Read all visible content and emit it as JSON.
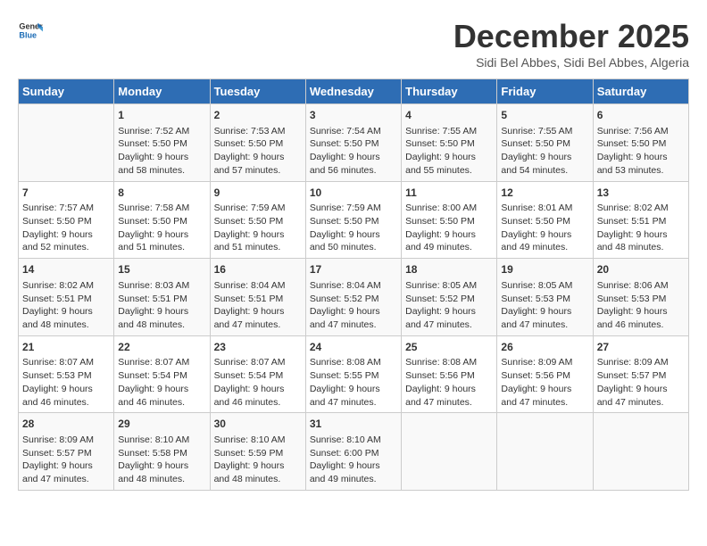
{
  "header": {
    "logo_line1": "General",
    "logo_line2": "Blue",
    "title": "December 2025",
    "subtitle": "Sidi Bel Abbes, Sidi Bel Abbes, Algeria"
  },
  "calendar": {
    "days_of_week": [
      "Sunday",
      "Monday",
      "Tuesday",
      "Wednesday",
      "Thursday",
      "Friday",
      "Saturday"
    ],
    "weeks": [
      [
        {
          "day": "",
          "info": ""
        },
        {
          "day": "1",
          "info": "Sunrise: 7:52 AM\nSunset: 5:50 PM\nDaylight: 9 hours\nand 58 minutes."
        },
        {
          "day": "2",
          "info": "Sunrise: 7:53 AM\nSunset: 5:50 PM\nDaylight: 9 hours\nand 57 minutes."
        },
        {
          "day": "3",
          "info": "Sunrise: 7:54 AM\nSunset: 5:50 PM\nDaylight: 9 hours\nand 56 minutes."
        },
        {
          "day": "4",
          "info": "Sunrise: 7:55 AM\nSunset: 5:50 PM\nDaylight: 9 hours\nand 55 minutes."
        },
        {
          "day": "5",
          "info": "Sunrise: 7:55 AM\nSunset: 5:50 PM\nDaylight: 9 hours\nand 54 minutes."
        },
        {
          "day": "6",
          "info": "Sunrise: 7:56 AM\nSunset: 5:50 PM\nDaylight: 9 hours\nand 53 minutes."
        }
      ],
      [
        {
          "day": "7",
          "info": "Sunrise: 7:57 AM\nSunset: 5:50 PM\nDaylight: 9 hours\nand 52 minutes."
        },
        {
          "day": "8",
          "info": "Sunrise: 7:58 AM\nSunset: 5:50 PM\nDaylight: 9 hours\nand 51 minutes."
        },
        {
          "day": "9",
          "info": "Sunrise: 7:59 AM\nSunset: 5:50 PM\nDaylight: 9 hours\nand 51 minutes."
        },
        {
          "day": "10",
          "info": "Sunrise: 7:59 AM\nSunset: 5:50 PM\nDaylight: 9 hours\nand 50 minutes."
        },
        {
          "day": "11",
          "info": "Sunrise: 8:00 AM\nSunset: 5:50 PM\nDaylight: 9 hours\nand 49 minutes."
        },
        {
          "day": "12",
          "info": "Sunrise: 8:01 AM\nSunset: 5:50 PM\nDaylight: 9 hours\nand 49 minutes."
        },
        {
          "day": "13",
          "info": "Sunrise: 8:02 AM\nSunset: 5:51 PM\nDaylight: 9 hours\nand 48 minutes."
        }
      ],
      [
        {
          "day": "14",
          "info": "Sunrise: 8:02 AM\nSunset: 5:51 PM\nDaylight: 9 hours\nand 48 minutes."
        },
        {
          "day": "15",
          "info": "Sunrise: 8:03 AM\nSunset: 5:51 PM\nDaylight: 9 hours\nand 48 minutes."
        },
        {
          "day": "16",
          "info": "Sunrise: 8:04 AM\nSunset: 5:51 PM\nDaylight: 9 hours\nand 47 minutes."
        },
        {
          "day": "17",
          "info": "Sunrise: 8:04 AM\nSunset: 5:52 PM\nDaylight: 9 hours\nand 47 minutes."
        },
        {
          "day": "18",
          "info": "Sunrise: 8:05 AM\nSunset: 5:52 PM\nDaylight: 9 hours\nand 47 minutes."
        },
        {
          "day": "19",
          "info": "Sunrise: 8:05 AM\nSunset: 5:53 PM\nDaylight: 9 hours\nand 47 minutes."
        },
        {
          "day": "20",
          "info": "Sunrise: 8:06 AM\nSunset: 5:53 PM\nDaylight: 9 hours\nand 46 minutes."
        }
      ],
      [
        {
          "day": "21",
          "info": "Sunrise: 8:07 AM\nSunset: 5:53 PM\nDaylight: 9 hours\nand 46 minutes."
        },
        {
          "day": "22",
          "info": "Sunrise: 8:07 AM\nSunset: 5:54 PM\nDaylight: 9 hours\nand 46 minutes."
        },
        {
          "day": "23",
          "info": "Sunrise: 8:07 AM\nSunset: 5:54 PM\nDaylight: 9 hours\nand 46 minutes."
        },
        {
          "day": "24",
          "info": "Sunrise: 8:08 AM\nSunset: 5:55 PM\nDaylight: 9 hours\nand 47 minutes."
        },
        {
          "day": "25",
          "info": "Sunrise: 8:08 AM\nSunset: 5:56 PM\nDaylight: 9 hours\nand 47 minutes."
        },
        {
          "day": "26",
          "info": "Sunrise: 8:09 AM\nSunset: 5:56 PM\nDaylight: 9 hours\nand 47 minutes."
        },
        {
          "day": "27",
          "info": "Sunrise: 8:09 AM\nSunset: 5:57 PM\nDaylight: 9 hours\nand 47 minutes."
        }
      ],
      [
        {
          "day": "28",
          "info": "Sunrise: 8:09 AM\nSunset: 5:57 PM\nDaylight: 9 hours\nand 47 minutes."
        },
        {
          "day": "29",
          "info": "Sunrise: 8:10 AM\nSunset: 5:58 PM\nDaylight: 9 hours\nand 48 minutes."
        },
        {
          "day": "30",
          "info": "Sunrise: 8:10 AM\nSunset: 5:59 PM\nDaylight: 9 hours\nand 48 minutes."
        },
        {
          "day": "31",
          "info": "Sunrise: 8:10 AM\nSunset: 6:00 PM\nDaylight: 9 hours\nand 49 minutes."
        },
        {
          "day": "",
          "info": ""
        },
        {
          "day": "",
          "info": ""
        },
        {
          "day": "",
          "info": ""
        }
      ]
    ]
  }
}
